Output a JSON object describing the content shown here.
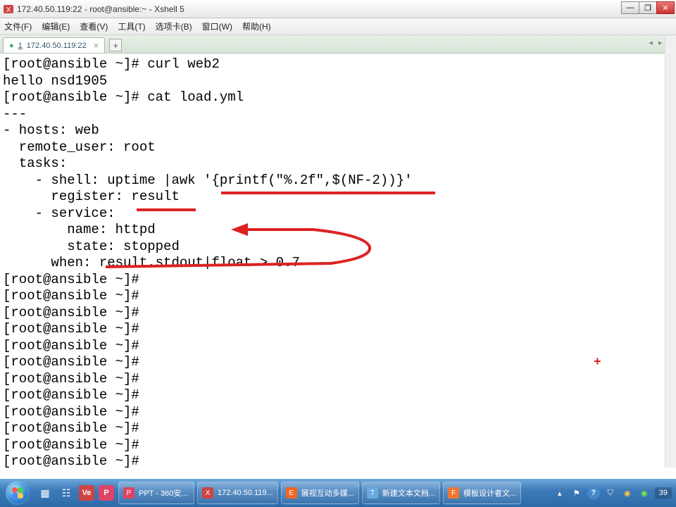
{
  "window": {
    "title": "172.40.50.119:22 - root@ansible:~ - Xshell 5"
  },
  "menu": {
    "file": "文件(F)",
    "edit": "编辑(E)",
    "view": "查看(V)",
    "tools": "工具(T)",
    "tabs": "选项卡(B)",
    "window": "窗口(W)",
    "help": "帮助(H)"
  },
  "tabs": {
    "active_prefix": "1",
    "active_label": "172.40.50.119:22",
    "add": "+"
  },
  "terminal": {
    "lines": [
      "[root@ansible ~]# curl web2",
      "hello nsd1905",
      "[root@ansible ~]# cat load.yml",
      "---",
      "- hosts: web",
      "  remote_user: root",
      "  tasks:",
      "    - shell: uptime |awk '{printf(\"%.2f\",$(NF-2))}'",
      "      register: result",
      "    - service:",
      "        name: httpd",
      "        state: stopped",
      "      when: result.stdout|float > 0.7",
      "[root@ansible ~]#",
      "[root@ansible ~]#",
      "[root@ansible ~]#",
      "[root@ansible ~]#",
      "[root@ansible ~]#",
      "[root@ansible ~]#",
      "[root@ansible ~]#",
      "[root@ansible ~]#",
      "[root@ansible ~]#",
      "[root@ansible ~]#",
      "[root@ansible ~]#",
      "[root@ansible ~]#"
    ]
  },
  "taskbar": {
    "items": [
      {
        "icon": "P",
        "icon_bg": "#d46",
        "label": "PPT - 360安..."
      },
      {
        "icon": "X",
        "icon_bg": "#c44",
        "label": "172.40.50.119..."
      },
      {
        "icon": "E",
        "icon_bg": "#e62",
        "label": "展视互动多媒..."
      },
      {
        "icon": "T",
        "icon_bg": "#6ad",
        "label": "新建文本文档..."
      },
      {
        "icon": "F",
        "icon_bg": "#e73",
        "label": "模板设计者文..."
      }
    ],
    "clock": "39"
  },
  "icons": {
    "minimize": "—",
    "maximize": "❐",
    "close": "✕",
    "chevron": "▾",
    "tabnav_l": "◂",
    "tabnav_r": "▸"
  }
}
